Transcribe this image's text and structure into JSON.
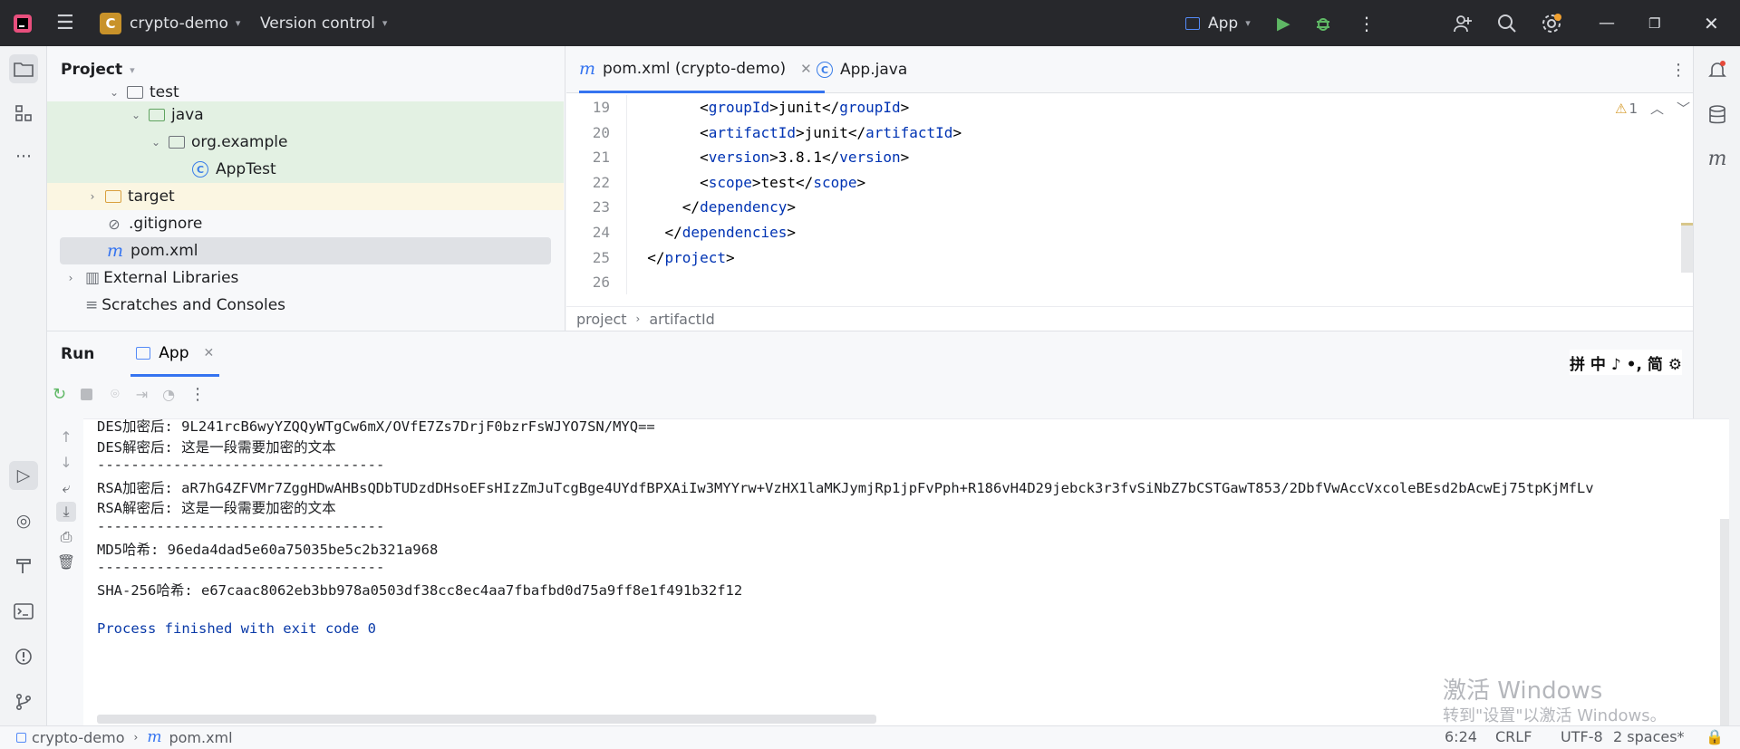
{
  "titlebar": {
    "project_badge": "C",
    "project_name": "crypto-demo",
    "vcs": "Version control",
    "run_config": "App"
  },
  "project_panel": {
    "title": "Project",
    "items": [
      {
        "label": "test"
      },
      {
        "label": "java"
      },
      {
        "label": "org.example"
      },
      {
        "label": "AppTest"
      },
      {
        "label": "target"
      },
      {
        "label": ".gitignore"
      },
      {
        "label": "pom.xml"
      },
      {
        "label": "External Libraries"
      },
      {
        "label": "Scratches and Consoles"
      }
    ]
  },
  "editor": {
    "tabs": [
      {
        "label": "pom.xml (crypto-demo)"
      },
      {
        "label": "App.java"
      }
    ],
    "warning_count": "1",
    "lines": [
      {
        "n": "19",
        "indent": "        ",
        "open": "groupId",
        "text": "junit",
        "close": "groupId"
      },
      {
        "n": "20",
        "indent": "        ",
        "open": "artifactId",
        "text": "junit",
        "close": "artifactId"
      },
      {
        "n": "21",
        "indent": "        ",
        "open": "version",
        "text": "3.8.1",
        "close": "version"
      },
      {
        "n": "22",
        "indent": "        ",
        "open": "scope",
        "text": "test",
        "close": "scope"
      },
      {
        "n": "23",
        "indent": "      ",
        "open": "",
        "text": "",
        "close": "dependency"
      },
      {
        "n": "24",
        "indent": "    ",
        "open": "",
        "text": "",
        "close": "dependencies"
      },
      {
        "n": "25",
        "indent": "  ",
        "open": "",
        "text": "",
        "close": "project"
      },
      {
        "n": "26",
        "indent": "",
        "open": "",
        "text": "",
        "close": ""
      }
    ],
    "breadcrumb": [
      "project",
      "artifactId"
    ]
  },
  "run_panel": {
    "title": "Run",
    "tab": "App",
    "console": [
      "DES加密后: 9L241rcB6wyYZQQyWTgCw6mX/OVfE7Zs7DrjF0bzrFsWJYO7SN/MYQ==",
      "DES解密后: 这是一段需要加密的文本",
      "----------------------------------",
      "RSA加密后: aR7hG4ZFVMr7ZggHDwAHBsQDbTUDzdDHsoEFsHIzZmJuTcgBge4UYdfBPXAiIw3MYYrw+VzHX1laMKJymjRp1jpFvPph+R186vH4D29jebck3r3fvSiNbZ7bCSTGawT853/2DbfVwAccVxcoleBEsd2bAcwEj75tpKjMfLv",
      "RSA解密后: 这是一段需要加密的文本",
      "----------------------------------",
      "MD5哈希: 96eda4dad5e60a75035be5c2b321a968",
      "----------------------------------",
      "SHA-256哈希: e67caac8062eb3bb978a0503df38cc8ec4aa7fbafbd0d75a9ff8e1f491b32f12",
      "",
      "Process finished with exit code 0"
    ]
  },
  "ime_bar": "拼 中 ♪ •, 简 ⚙",
  "watermark": {
    "line1": "激活 Windows",
    "line2": "转到\"设置\"以激活 Windows。"
  },
  "statusbar": {
    "path": [
      "crypto-demo",
      "pom.xml"
    ],
    "position": "6:24",
    "line_sep": "CRLF",
    "encoding": "UTF-8",
    "indent": "2 spaces*"
  }
}
